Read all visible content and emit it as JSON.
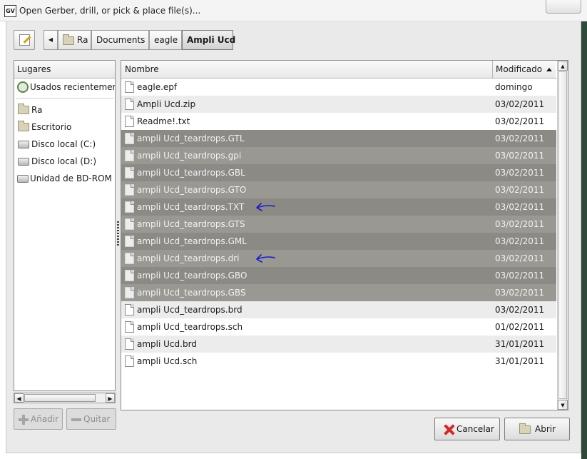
{
  "window": {
    "title": "Open Gerber, drill, or pick & place file(s)...",
    "app_icon_text": "GV"
  },
  "path_bar": {
    "back_arrow": "◀",
    "crumbs": [
      "Ra",
      "Documents",
      "eagle",
      "Ampli Ucd"
    ]
  },
  "places": {
    "header": "Lugares",
    "items": [
      {
        "label": "Usados recientemente",
        "icon": "recent-icon"
      },
      {
        "label": "Ra",
        "icon": "folder-icon"
      },
      {
        "label": "Escritorio",
        "icon": "folder-icon"
      },
      {
        "label": "Disco local (C:)",
        "icon": "drive-icon"
      },
      {
        "label": "Disco local (D:)",
        "icon": "drive-icon"
      },
      {
        "label": "Unidad de BD-ROM (",
        "icon": "drive-icon"
      }
    ],
    "add_label": "Añadir",
    "remove_label": "Quitar"
  },
  "files": {
    "col_name": "Nombre",
    "col_modified": "Modificado",
    "rows": [
      {
        "name": "eagle.epf",
        "date": "domingo",
        "selected": false
      },
      {
        "name": "Ampli Ucd.zip",
        "date": "03/02/2011",
        "selected": false
      },
      {
        "name": "Readme!.txt",
        "date": "03/02/2011",
        "selected": false
      },
      {
        "name": "ampli Ucd_teardrops.GTL",
        "date": "03/02/2011",
        "selected": true
      },
      {
        "name": "ampli Ucd_teardrops.gpi",
        "date": "03/02/2011",
        "selected": true
      },
      {
        "name": "ampli Ucd_teardrops.GBL",
        "date": "03/02/2011",
        "selected": true
      },
      {
        "name": "ampli Ucd_teardrops.GTO",
        "date": "03/02/2011",
        "selected": true
      },
      {
        "name": "ampli Ucd_teardrops.TXT",
        "date": "03/02/2011",
        "selected": true,
        "annotated": true
      },
      {
        "name": "ampli Ucd_teardrops.GTS",
        "date": "03/02/2011",
        "selected": true
      },
      {
        "name": "ampli Ucd_teardrops.GML",
        "date": "03/02/2011",
        "selected": true
      },
      {
        "name": "ampli Ucd_teardrops.dri",
        "date": "03/02/2011",
        "selected": true,
        "annotated": true
      },
      {
        "name": "ampli Ucd_teardrops.GBO",
        "date": "03/02/2011",
        "selected": true
      },
      {
        "name": "ampli Ucd_teardrops.GBS",
        "date": "03/02/2011",
        "selected": true
      },
      {
        "name": "ampli Ucd_teardrops.brd",
        "date": "03/02/2011",
        "selected": false
      },
      {
        "name": "ampli Ucd_teardrops.sch",
        "date": "01/02/2011",
        "selected": false
      },
      {
        "name": "ampli Ucd.brd",
        "date": "31/01/2011",
        "selected": false
      },
      {
        "name": "ampli Ucd.sch",
        "date": "31/01/2011",
        "selected": false
      }
    ]
  },
  "actions": {
    "cancel_label": "Cancelar",
    "open_label": "Abrir"
  },
  "colors": {
    "selection": "#8b8a85",
    "annotation_arrow": "#1a1acc",
    "cancel_icon": "#d12b2b"
  }
}
